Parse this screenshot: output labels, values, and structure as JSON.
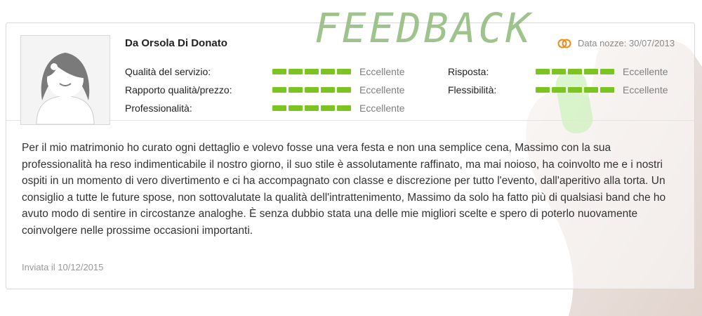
{
  "overlay": {
    "title": "FEEDBACK"
  },
  "review": {
    "author": "Da Orsola Di Donato",
    "wedding_date": "Data nozze: 30/07/2013",
    "ratings_left": [
      {
        "label": "Qualità del servizio:",
        "value": "Eccellente",
        "level": 5
      },
      {
        "label": "Rapporto qualità/prezzo:",
        "value": "Eccellente",
        "level": 5
      },
      {
        "label": "Professionalità:",
        "value": "Eccellente",
        "level": 5
      }
    ],
    "ratings_right": [
      {
        "label": "Risposta:",
        "value": "Eccellente",
        "level": 5
      },
      {
        "label": "Flessibilità:",
        "value": "Eccellente",
        "level": 5
      }
    ],
    "text": "Per il mio matrimonio ho curato ogni dettaglio e volevo fosse una vera festa e non una semplice cena, Massimo con la sua professionalità ha reso indimenticabile il nostro giorno, il suo stile è assolutamente raffinato, ma mai noioso, ha coinvolto me e i nostri ospiti in un momento di vero divertimento e ci ha accompagnato con classe e discrezione per tutto l'evento, dall'aperitivo alla torta. Un consiglio a tutte le future spose, non sottovalutate la qualità dell'intrattenimento, Massimo da solo ha fatto più di qualsiasi band che ho avuto modo di sentire in circostanze analoghe. È senza dubbio stata una delle mie migliori scelte e spero di poterlo nuovamente coinvolgere nelle prossime occasioni importanti.",
    "sent": "Inviata il 10/12/2015"
  },
  "icons": {
    "avatar": "female-avatar-icon",
    "rings": "wedding-rings-icon"
  },
  "colors": {
    "rating_bar": "#7cc520",
    "feedback_text": "#8fb97a"
  }
}
